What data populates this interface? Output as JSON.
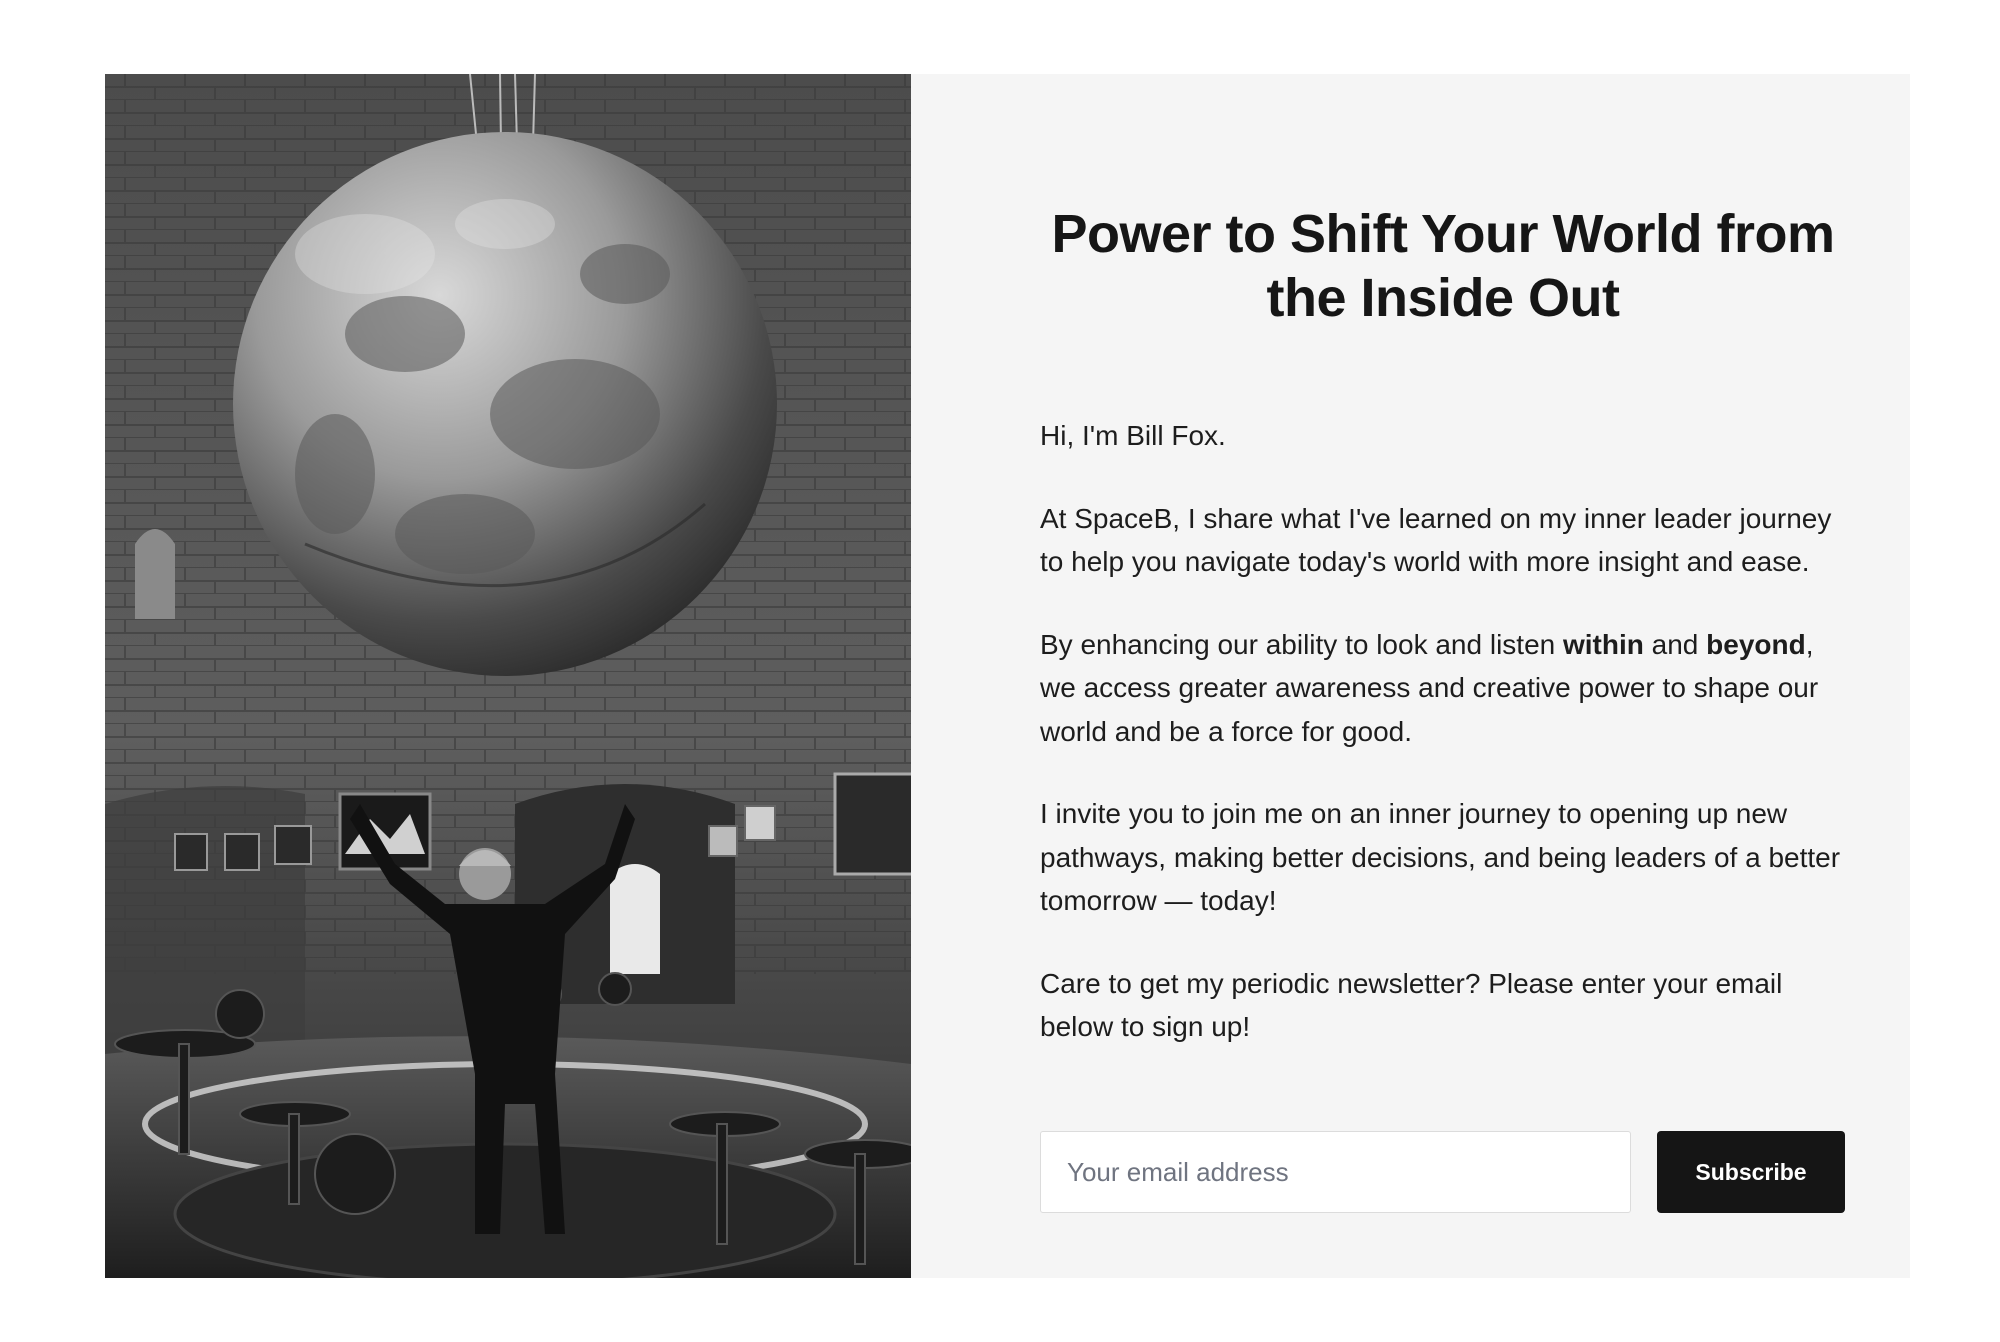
{
  "hero": {
    "headline": "Power to Shift Your World from the Inside Out",
    "greeting": "Hi, I'm Bill Fox.",
    "para_spaceb": "At SpaceB, I share what I've learned on my inner leader journey to help you navigate today's world with more insight and ease.",
    "para_enhance_start": "By enhancing our ability to look and listen ",
    "para_enhance_bold1": "within",
    "para_enhance_mid": " and ",
    "para_enhance_bold2": "beyond",
    "para_enhance_end": ", we access greater awareness and creative power to shape our world and be a force for good.",
    "para_invite": "I invite you to join me on an inner journey to opening up new pathways, making better decisions, and being leaders of a better tomorrow — today!",
    "para_newsletter": "Care to get my periodic newsletter? Please enter your email below to sign up!"
  },
  "signup": {
    "email_placeholder": "Your email address",
    "email_value": "",
    "subscribe_label": "Subscribe"
  },
  "colors": {
    "panel_background": "#f5f5f5",
    "button_background": "#151515",
    "button_text": "#ffffff",
    "headline_text": "#161616"
  }
}
